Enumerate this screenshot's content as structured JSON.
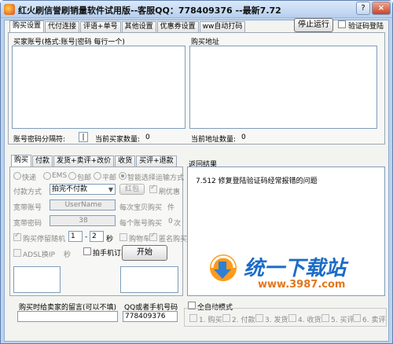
{
  "window": {
    "title": "红火刷信誉刷销量软件试用版--客服QQ：778409376 --最新7.72",
    "help_glyph": "?",
    "close_glyph": "×"
  },
  "top_tabs": [
    {
      "label": "购买设置",
      "active": true
    },
    {
      "label": "代付连接"
    },
    {
      "label": "评语+单号"
    },
    {
      "label": "其他设置"
    },
    {
      "label": "优惠券设置"
    },
    {
      "label": "ww自动打码"
    }
  ],
  "stop_button": "停止运行",
  "verify_login_label": "验证码登陆",
  "buyer_accounts_label": "买家账号(格式:账号|密码 每行一个)",
  "buy_address_label": "购买地址",
  "separator_label": "账号密码分隔符:",
  "separator_value": "|",
  "current_buyers_label": "当前买家数量:",
  "current_buyers_value": "0",
  "current_address_label": "当前地址数量:",
  "current_address_value": "0",
  "bottom_tabs": [
    {
      "label": "购买",
      "active": true
    },
    {
      "label": "付款"
    },
    {
      "label": "发货+卖评+改价"
    },
    {
      "label": "收货"
    },
    {
      "label": "买评+退款"
    }
  ],
  "shipping_options": [
    "快递",
    "EMS",
    "包邮",
    "平邮",
    "智能选择运输方式"
  ],
  "payment_method_label": "付款方式",
  "payment_method_value": "拍完不付款",
  "red_packet_label": "红包",
  "refresh_coupon_label": "刷优惠",
  "wangwang_label": "宽带账号",
  "wangwang_value": "UserName",
  "each_buy_label": "每次宝贝购买",
  "each_buy_unit": "件",
  "password_label": "宽带密码",
  "password_value": "38",
  "account_buy_label": "每个账号购买",
  "account_buy_value": "0",
  "account_buy_unit": "次",
  "stay_random_label": "购买停留随机",
  "stay_from": "1",
  "stay_dash": "-",
  "stay_to": "2",
  "stay_unit": "秒",
  "cart_label": "购物车",
  "anonymous_label": "匿名购买",
  "adsl_label": "ADSL换IP",
  "adsl_unit": "秒",
  "phone_order_label": "拍手机订单",
  "start_button": "开始",
  "return_result_label": "返回结果",
  "result_lines": [
    "7.512   修复登陆验证码经常报错的问题"
  ],
  "message_label": "购买时给卖家的留言(可以不填)",
  "qq_label": "QQ或者手机号码",
  "qq_value": "778409376",
  "full_auto_label": "全自动模式",
  "auto_steps": [
    "1. 购买",
    "2. 付款",
    "3. 发货",
    "4. 收货",
    "5. 买评",
    "6. 卖评"
  ],
  "watermark": {
    "brand": "统一下载站",
    "url": "www.3987.com"
  }
}
